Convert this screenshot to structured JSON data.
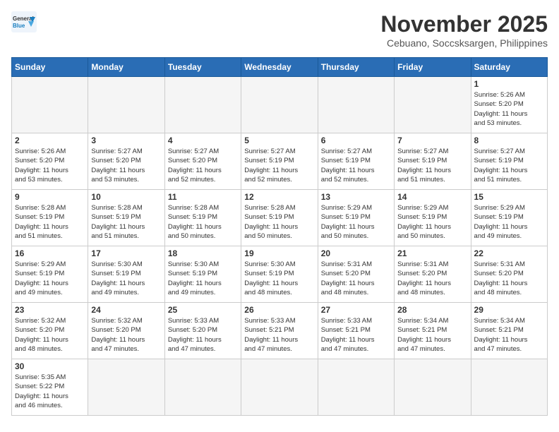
{
  "logo": {
    "line1": "General",
    "line2": "Blue"
  },
  "title": "November 2025",
  "subtitle": "Cebuano, Soccsksargen, Philippines",
  "days_of_week": [
    "Sunday",
    "Monday",
    "Tuesday",
    "Wednesday",
    "Thursday",
    "Friday",
    "Saturday"
  ],
  "weeks": [
    [
      {
        "day": "",
        "info": ""
      },
      {
        "day": "",
        "info": ""
      },
      {
        "day": "",
        "info": ""
      },
      {
        "day": "",
        "info": ""
      },
      {
        "day": "",
        "info": ""
      },
      {
        "day": "",
        "info": ""
      },
      {
        "day": "1",
        "info": "Sunrise: 5:26 AM\nSunset: 5:20 PM\nDaylight: 11 hours\nand 53 minutes."
      }
    ],
    [
      {
        "day": "2",
        "info": "Sunrise: 5:26 AM\nSunset: 5:20 PM\nDaylight: 11 hours\nand 53 minutes."
      },
      {
        "day": "3",
        "info": "Sunrise: 5:27 AM\nSunset: 5:20 PM\nDaylight: 11 hours\nand 53 minutes."
      },
      {
        "day": "4",
        "info": "Sunrise: 5:27 AM\nSunset: 5:20 PM\nDaylight: 11 hours\nand 52 minutes."
      },
      {
        "day": "5",
        "info": "Sunrise: 5:27 AM\nSunset: 5:19 PM\nDaylight: 11 hours\nand 52 minutes."
      },
      {
        "day": "6",
        "info": "Sunrise: 5:27 AM\nSunset: 5:19 PM\nDaylight: 11 hours\nand 52 minutes."
      },
      {
        "day": "7",
        "info": "Sunrise: 5:27 AM\nSunset: 5:19 PM\nDaylight: 11 hours\nand 51 minutes."
      },
      {
        "day": "8",
        "info": "Sunrise: 5:27 AM\nSunset: 5:19 PM\nDaylight: 11 hours\nand 51 minutes."
      }
    ],
    [
      {
        "day": "9",
        "info": "Sunrise: 5:28 AM\nSunset: 5:19 PM\nDaylight: 11 hours\nand 51 minutes."
      },
      {
        "day": "10",
        "info": "Sunrise: 5:28 AM\nSunset: 5:19 PM\nDaylight: 11 hours\nand 51 minutes."
      },
      {
        "day": "11",
        "info": "Sunrise: 5:28 AM\nSunset: 5:19 PM\nDaylight: 11 hours\nand 50 minutes."
      },
      {
        "day": "12",
        "info": "Sunrise: 5:28 AM\nSunset: 5:19 PM\nDaylight: 11 hours\nand 50 minutes."
      },
      {
        "day": "13",
        "info": "Sunrise: 5:29 AM\nSunset: 5:19 PM\nDaylight: 11 hours\nand 50 minutes."
      },
      {
        "day": "14",
        "info": "Sunrise: 5:29 AM\nSunset: 5:19 PM\nDaylight: 11 hours\nand 50 minutes."
      },
      {
        "day": "15",
        "info": "Sunrise: 5:29 AM\nSunset: 5:19 PM\nDaylight: 11 hours\nand 49 minutes."
      }
    ],
    [
      {
        "day": "16",
        "info": "Sunrise: 5:29 AM\nSunset: 5:19 PM\nDaylight: 11 hours\nand 49 minutes."
      },
      {
        "day": "17",
        "info": "Sunrise: 5:30 AM\nSunset: 5:19 PM\nDaylight: 11 hours\nand 49 minutes."
      },
      {
        "day": "18",
        "info": "Sunrise: 5:30 AM\nSunset: 5:19 PM\nDaylight: 11 hours\nand 49 minutes."
      },
      {
        "day": "19",
        "info": "Sunrise: 5:30 AM\nSunset: 5:19 PM\nDaylight: 11 hours\nand 48 minutes."
      },
      {
        "day": "20",
        "info": "Sunrise: 5:31 AM\nSunset: 5:20 PM\nDaylight: 11 hours\nand 48 minutes."
      },
      {
        "day": "21",
        "info": "Sunrise: 5:31 AM\nSunset: 5:20 PM\nDaylight: 11 hours\nand 48 minutes."
      },
      {
        "day": "22",
        "info": "Sunrise: 5:31 AM\nSunset: 5:20 PM\nDaylight: 11 hours\nand 48 minutes."
      }
    ],
    [
      {
        "day": "23",
        "info": "Sunrise: 5:32 AM\nSunset: 5:20 PM\nDaylight: 11 hours\nand 48 minutes."
      },
      {
        "day": "24",
        "info": "Sunrise: 5:32 AM\nSunset: 5:20 PM\nDaylight: 11 hours\nand 47 minutes."
      },
      {
        "day": "25",
        "info": "Sunrise: 5:33 AM\nSunset: 5:20 PM\nDaylight: 11 hours\nand 47 minutes."
      },
      {
        "day": "26",
        "info": "Sunrise: 5:33 AM\nSunset: 5:21 PM\nDaylight: 11 hours\nand 47 minutes."
      },
      {
        "day": "27",
        "info": "Sunrise: 5:33 AM\nSunset: 5:21 PM\nDaylight: 11 hours\nand 47 minutes."
      },
      {
        "day": "28",
        "info": "Sunrise: 5:34 AM\nSunset: 5:21 PM\nDaylight: 11 hours\nand 47 minutes."
      },
      {
        "day": "29",
        "info": "Sunrise: 5:34 AM\nSunset: 5:21 PM\nDaylight: 11 hours\nand 47 minutes."
      }
    ],
    [
      {
        "day": "30",
        "info": "Sunrise: 5:35 AM\nSunset: 5:22 PM\nDaylight: 11 hours\nand 46 minutes."
      },
      {
        "day": "",
        "info": ""
      },
      {
        "day": "",
        "info": ""
      },
      {
        "day": "",
        "info": ""
      },
      {
        "day": "",
        "info": ""
      },
      {
        "day": "",
        "info": ""
      },
      {
        "day": "",
        "info": ""
      }
    ]
  ]
}
